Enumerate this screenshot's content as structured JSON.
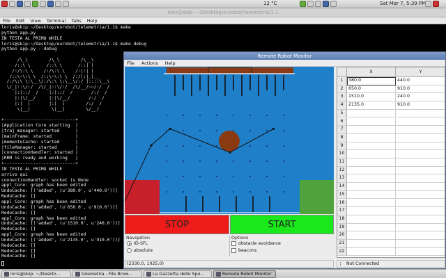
{
  "top_panel": {
    "menu_icons": [
      "app-icon",
      "terminal-icon",
      "browser-icon",
      "mail-icon",
      "folder-icon",
      "editor-icon",
      "image-icon",
      "settings-icon",
      "monitor-icon"
    ],
    "temperature": "12 °C",
    "clock": "Sat Mar  7,  5:39 PM"
  },
  "terminal": {
    "title": "loris@skip: ~/Desktop/eurobot/telemetria/1.1",
    "menu": [
      "File",
      "Edit",
      "View",
      "Terminal",
      "Tabs",
      "Help"
    ],
    "lines": [
      "loris@skip:~/Desktop/eurobot/telemetria/1.1$ make",
      "python app.py",
      "IN TESTA AL PRIMO WHILE",
      "loris@skip:~/Desktop/eurobot/telemetria/1.1$ make debug",
      "python app.py --debug",
      "",
      "      /\\_\\        /\\_\\        /\\__\\",
      "     /::\\ \\      /::\\ \\      /::| |",
      "    /:/\\:\\ \\    /:/\\:\\ \\    /:|:| |",
      "   /::\\~\\:\\ \\  /::\\~\\:\\ \\  /:/|:|_|__",
      "  /:/\\:\\ \\:\\__\\/:/\\:\\ \\:\\__\\/:/ |::::\\__\\",
      "  \\/_|::\\/:/  /\\/_|::\\/:/  /\\/__/~~/:/  /",
      "     |:|::/  /    |:|::/  /       /:/  /",
      "     |:|\\/__/     |:|\\/__/       /:/  /",
      "     |:|  |       |:|  |        /:/  /",
      "      \\|__|        \\|__|        \\/__/",
      "",
      "+---------------------------+",
      "|Application Core starting  |",
      "|traj_manager: started      |",
      "|mainFrame: started         |",
      "|mementoCache: started      |",
      "|fileManager: started       |",
      "|connectionHandler: started |",
      "|RRM is ready and working   |",
      "+---------------------------+",
      "IN TESTA AL PRIMO WHILE",
      "arrivo qui",
      "connectionHandler: socket is None",
      "appl_Core: graph has been edited",
      "UndoCache: [('added', (u'380.0', u'440.0'))]",
      "RedoCache: []",
      "appl_Core: graph has been edited",
      "UndoCache: [('added', (u'650.0', u'910.0'))]",
      "RedoCache: []",
      "appl_Core: graph has been edited",
      "UndoCache: [('added', (u'1510.0', u'240.0'))]",
      "RedoCache: []",
      "appl_Core: graph has been edited",
      "UndoCache: [('added', (u'2135.0', u'910.0'))]",
      "RedoCache: []",
      "RedoCache: []",
      "RedoCache: []"
    ]
  },
  "monitor": {
    "title": "Remote Robot Monitor",
    "menu": [
      "File",
      "Actions",
      "Help"
    ],
    "stop_label": "STOP",
    "start_label": "START",
    "navigation_label": "Navigation",
    "nav_options": [
      "ID-SFL",
      "absolute"
    ],
    "nav_selected": 0,
    "options_label": "Options",
    "options": [
      "obstacle avoidance",
      "beacons"
    ],
    "status_coords": "(2330.0, 1025.0)",
    "status_connection": "Not Connected",
    "colors": {
      "field": "#1f7fc9",
      "stop": "#ee1b1b",
      "start": "#1be81b",
      "red_zone": "#c8202a",
      "green_zone": "#4ea33c",
      "ball": "#8a3a10",
      "top_bar": "#8a3a14"
    },
    "table": {
      "columns": [
        "X",
        "Y"
      ],
      "rows": [
        {
          "n": "1",
          "x": "380.0",
          "y": "440.0"
        },
        {
          "n": "2",
          "x": "650.0",
          "y": "910.0"
        },
        {
          "n": "3",
          "x": "1510.0",
          "y": "240.0"
        },
        {
          "n": "4",
          "x": "2135.0",
          "y": "910.0"
        },
        {
          "n": "5",
          "x": "",
          "y": ""
        },
        {
          "n": "6",
          "x": "",
          "y": ""
        },
        {
          "n": "7",
          "x": "",
          "y": ""
        },
        {
          "n": "8",
          "x": "",
          "y": ""
        },
        {
          "n": "9",
          "x": "",
          "y": ""
        },
        {
          "n": "10",
          "x": "",
          "y": ""
        },
        {
          "n": "11",
          "x": "",
          "y": ""
        },
        {
          "n": "12",
          "x": "",
          "y": ""
        },
        {
          "n": "13",
          "x": "",
          "y": ""
        },
        {
          "n": "14",
          "x": "",
          "y": ""
        },
        {
          "n": "15",
          "x": "",
          "y": ""
        },
        {
          "n": "16",
          "x": "",
          "y": ""
        },
        {
          "n": "17",
          "x": "",
          "y": ""
        },
        {
          "n": "18",
          "x": "",
          "y": ""
        },
        {
          "n": "19",
          "x": "",
          "y": ""
        },
        {
          "n": "20",
          "x": "",
          "y": ""
        },
        {
          "n": "21",
          "x": "",
          "y": ""
        },
        {
          "n": "22",
          "x": "",
          "y": ""
        }
      ]
    }
  },
  "taskbar": {
    "tasks": [
      {
        "label": "loris@skip: ~/Deskto...",
        "icon": "terminal-icon",
        "active": false
      },
      {
        "label": "telemetria - File Brow...",
        "icon": "folder-icon",
        "active": false
      },
      {
        "label": "La Gazzetta dello Spo...",
        "icon": "browser-icon",
        "active": false
      },
      {
        "label": "Remote Robot Monitor",
        "icon": "app-icon",
        "active": true
      }
    ]
  }
}
